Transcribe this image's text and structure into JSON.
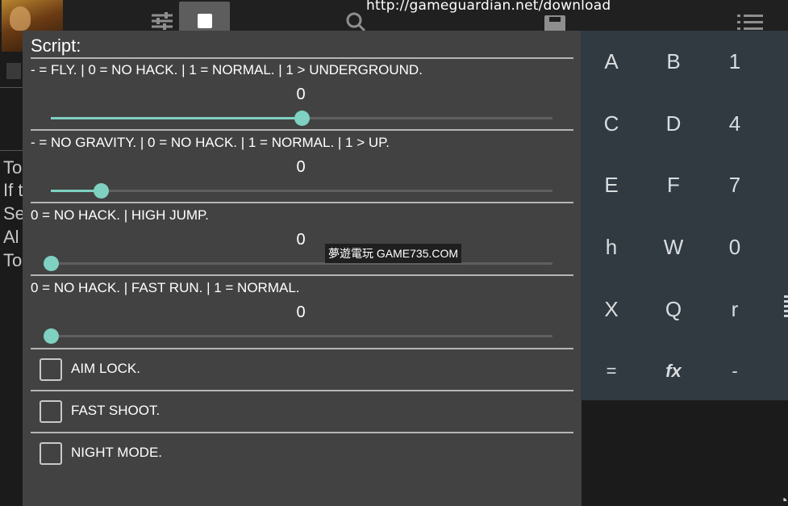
{
  "app": {
    "url": "http://gameguardian.net/download",
    "bg_fragments": [
      "To",
      "If t",
      "Se",
      "Al",
      "To"
    ]
  },
  "top_icons": {
    "settings": "sliders-icon",
    "stop": "stop-icon",
    "search": "search-icon",
    "save": "save-icon",
    "menu": "list-icon"
  },
  "dialog": {
    "title": "Script:",
    "sliders": [
      {
        "label": "- = FLY. | 0 = NO HACK. | 1 = NORMAL. | 1 > UNDERGROUND.",
        "value": "0",
        "level": 0.5
      },
      {
        "label": "- = NO GRAVITY. | 0 = NO HACK. | 1 = NORMAL. | 1 > UP.",
        "value": "0",
        "level": 0.1
      },
      {
        "label": "0 = NO HACK. | HIGH JUMP.",
        "value": "0",
        "level": 0.0
      },
      {
        "label": "0 = NO HACK. | FAST RUN. | 1 = NORMAL.",
        "value": "0",
        "level": 0.0
      }
    ],
    "checkboxes": [
      {
        "label": "AIM LOCK.",
        "checked": false
      },
      {
        "label": "FAST SHOOT.",
        "checked": false
      },
      {
        "label": "NIGHT MODE.",
        "checked": false
      }
    ],
    "watermark": "夢遊電玩 GAME735.COM",
    "accent_color": "#7fd1c2"
  },
  "keypad": {
    "keys": [
      [
        "A",
        "B",
        "1"
      ],
      [
        "C",
        "D",
        "4"
      ],
      [
        "E",
        "F",
        "7"
      ],
      [
        "h",
        "W",
        "0"
      ],
      [
        "X",
        "Q",
        "r"
      ],
      [
        "=",
        "fx",
        "-"
      ]
    ]
  }
}
